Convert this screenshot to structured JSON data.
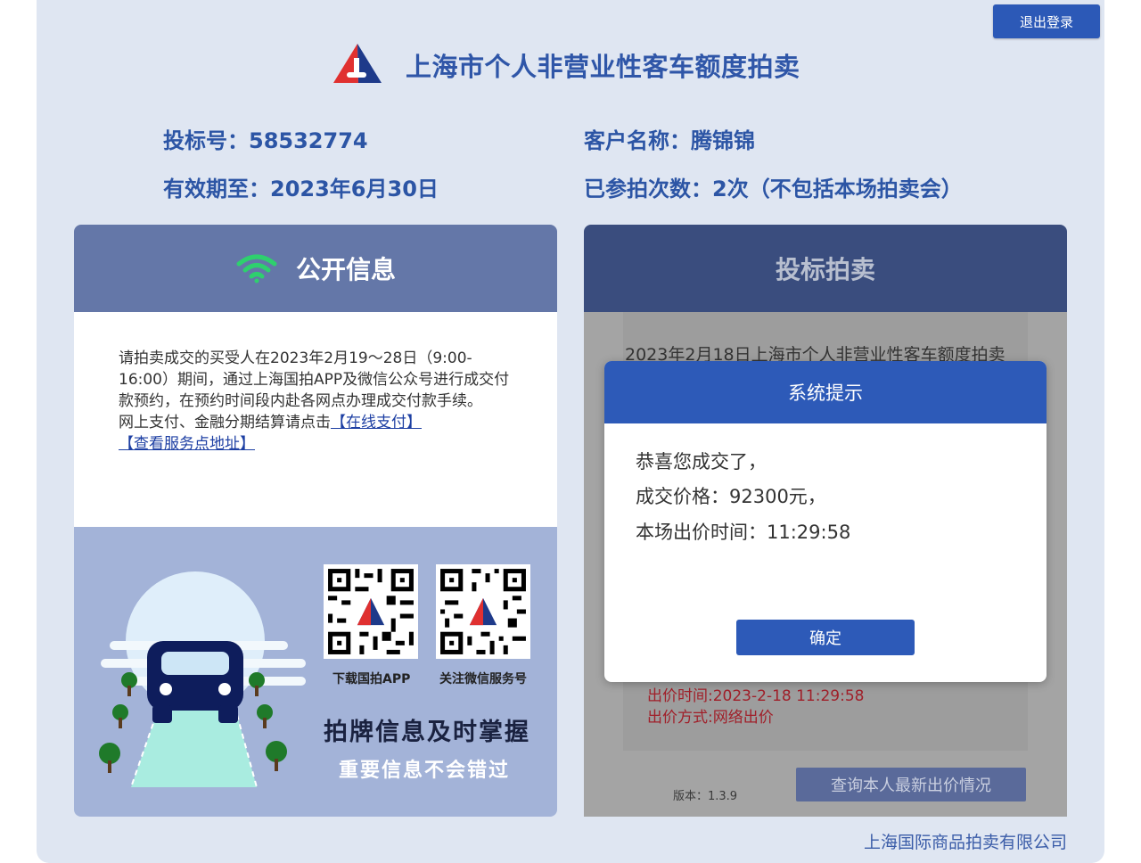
{
  "header": {
    "logout_label": "退出登录",
    "title": "上海市个人非营业性客车额度拍卖"
  },
  "account": {
    "bid_no": "投标号：58532774",
    "customer": "客户名称：腾锦锦",
    "valid_until": "有效期至：2023年6月30日",
    "participations": "已参拍次数：2次（不包括本场拍卖会）"
  },
  "public_info": {
    "heading": "公开信息",
    "icon": "wifi-icon",
    "notice_text": "请拍卖成交的买受人在2023年2月19～28日（9:00-16:00）期间，通过上海国拍APP及微信公众号进行成交付款预约，在预约时间段内赴各网点办理成交付款手续。",
    "notice_pay_prefix": "网上支付、金融分期结算请点击",
    "pay_link": "【在线支付】",
    "service_link": "【查看服务点地址】",
    "qr_app_caption": "下载国拍APP",
    "qr_wechat_caption": "关注微信服务号",
    "slogan_main": "拍牌信息及时掌握",
    "slogan_sub": "重要信息不会错过"
  },
  "bidding": {
    "heading": "投标拍卖",
    "auction_title": "2023年2月18日上海市个人非营业性客车额度拍卖",
    "bid_time": "出价时间:2023-2-18 11:29:58",
    "bid_method": "出价方式:网络出价",
    "version": "版本：1.3.9",
    "query_button": "查询本人最新出价情况"
  },
  "modal": {
    "title": "系统提示",
    "line1": "恭喜您成交了，",
    "line2": "成交价格：92300元，",
    "line3": "本场出价时间：11:29:58",
    "confirm_label": "确定"
  },
  "footer": {
    "company": "上海国际商品拍卖有限公司"
  },
  "colors": {
    "primary": "#2d5ab8",
    "page_bg": "#dfe6f2",
    "title": "#2f56a8",
    "alert_red": "#a0202a"
  }
}
